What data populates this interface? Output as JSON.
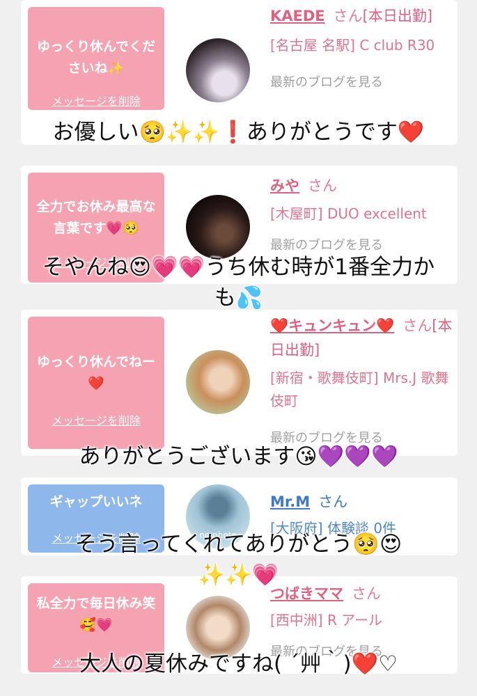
{
  "cards": [
    {
      "message": "ゆっくり休んでくださいね✨",
      "delete_label": "メッセージを削除",
      "name": "KAEDE",
      "honorific": "さん",
      "status": "[本日出勤]",
      "shop": "[名古屋 名駅] C club R30",
      "blog_link": "最新のブログを見る"
    },
    {
      "message": "全力でお休み最高な言葉です💗🥺",
      "delete_label": "メッセージを削除",
      "name": "みや",
      "honorific": "さん",
      "status": "",
      "shop": "[木屋町] DUO excellent",
      "blog_link": "最新のブログを見る"
    },
    {
      "message": "ゆっくり休んでねー❤️",
      "delete_label": "メッセージを削除",
      "name": "❤️キュンキュン❤️",
      "honorific": "さん",
      "status": "[本日出勤]",
      "shop": "[新宿・歌舞伎町] Mrs.J 歌舞伎町",
      "blog_link": "最新のブログを見る"
    },
    {
      "message": "ギャップいいネ",
      "delete_label": "メッセージを削除",
      "name": "Mr.M",
      "honorific": "さん",
      "status": "",
      "shop": "[大阪府] 体験談 0件",
      "blog_link": "",
      "avatar_text": "no photo"
    },
    {
      "message": "私全力で毎日休み笑🥰💗",
      "delete_label": "メッセージを削除",
      "name": "つばきママ",
      "honorific": "さん",
      "status": "",
      "shop": "[西中洲] R アール",
      "blog_link": "最新のブログを見る"
    }
  ],
  "captions": [
    "お優しい🥺✨✨❗ありがとうです❤️",
    "そやんね😍💗💗うち休む時が1番全力か",
    "も💦",
    "ありがとうございます😘💜💜💜",
    "そう言ってくれてありがとう🥺😍",
    "✨✨💗",
    "大人の夏休みですね( ´艸｀)❤️♡"
  ],
  "colors": {
    "pink_bubble": "#f5a3b2",
    "blue_bubble": "#8eb8ec",
    "pink_text": "#e06080",
    "blue_text": "#3f79c9"
  }
}
